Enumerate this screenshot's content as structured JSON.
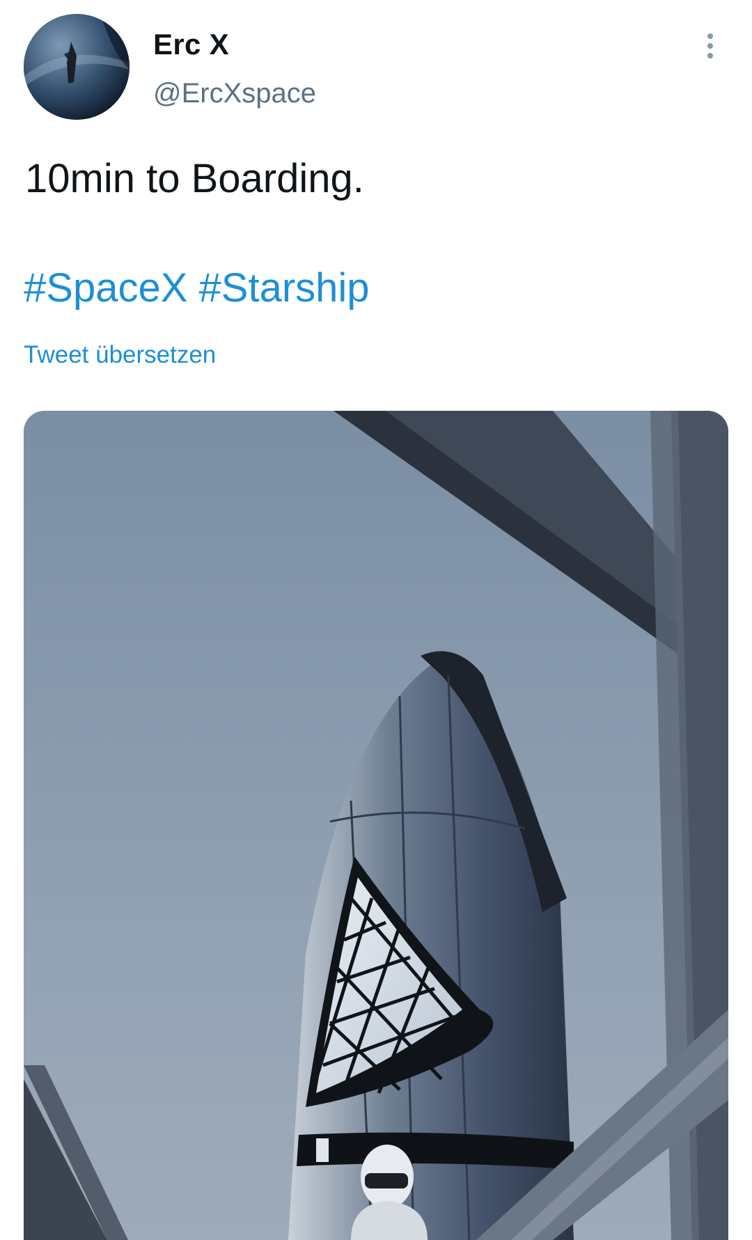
{
  "tweet": {
    "author": {
      "display_name": "Erc X",
      "handle": "@ErcXspace",
      "avatar_icon": "avatar-rocket-image"
    },
    "text": "10min to Boarding.",
    "hashtags": [
      "#SpaceX",
      "#Starship"
    ],
    "translate_label": "Tweet übersetzen",
    "more_icon": "more-vertical-icon",
    "media": {
      "type": "image"
    }
  },
  "colors": {
    "link": "#1d8fd6",
    "handle": "#5b7083",
    "text": "#0f1419"
  }
}
